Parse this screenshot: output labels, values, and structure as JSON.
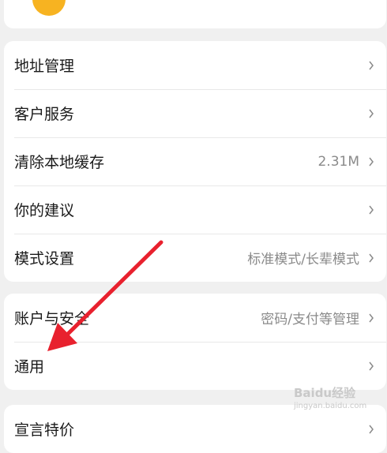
{
  "menu_group_1": [
    {
      "label": "地址管理",
      "value": ""
    },
    {
      "label": "客户服务",
      "value": ""
    },
    {
      "label": "清除本地缓存",
      "value": "2.31M"
    },
    {
      "label": "你的建议",
      "value": ""
    },
    {
      "label": "模式设置",
      "value": "标准模式/长辈模式"
    }
  ],
  "menu_group_2": [
    {
      "label": "账户与安全",
      "value": "密码/支付等管理"
    },
    {
      "label": "通用",
      "value": ""
    }
  ],
  "menu_group_3": [
    {
      "label": "宣言特价",
      "value": ""
    }
  ],
  "watermark": {
    "brand": "Baidu经验",
    "url": "jingyan.baidu.com"
  },
  "colors": {
    "arrow": "#e8212e",
    "avatar": "#f7b321",
    "background": "#f0f0f0"
  },
  "icons": {
    "chevron": "chevron-right-icon"
  }
}
